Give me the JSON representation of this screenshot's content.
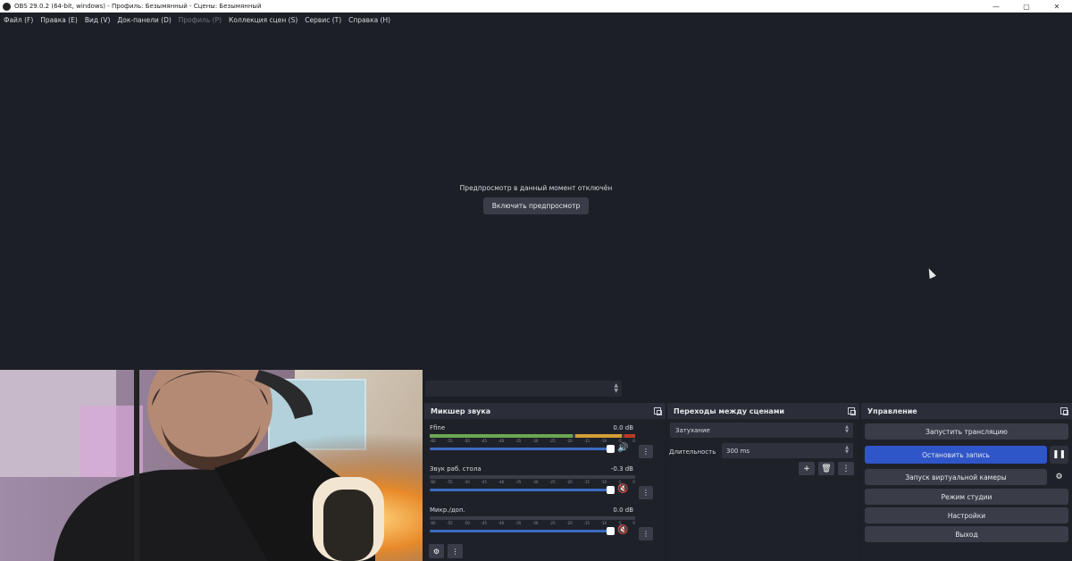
{
  "window": {
    "title": "OBS 29.0.2 (64-bit, windows) - Профиль: Безымянный - Сцены: Безымянный",
    "minimize": "—",
    "maximize": "▢",
    "close": "✕"
  },
  "menu": [
    {
      "label": "Файл (F)",
      "enabled": true
    },
    {
      "label": "Правка (E)",
      "enabled": true
    },
    {
      "label": "Вид (V)",
      "enabled": true
    },
    {
      "label": "Док-панели (D)",
      "enabled": true
    },
    {
      "label": "Профиль (P)",
      "enabled": false
    },
    {
      "label": "Коллекция сцен (S)",
      "enabled": true
    },
    {
      "label": "Сервис (T)",
      "enabled": true
    },
    {
      "label": "Справка (H)",
      "enabled": true
    }
  ],
  "preview": {
    "message": "Предпросмотр в данный момент отключён",
    "enable_button": "Включить предпросмотр"
  },
  "mixer": {
    "title": "Микшер звука",
    "ticks": [
      "-60",
      "-55",
      "-50",
      "-45",
      "-40",
      "-35",
      "-30",
      "-25",
      "-20",
      "-15",
      "-10",
      "-5",
      "0"
    ],
    "channels": [
      {
        "name": "Ffine",
        "db": "0.0 dB",
        "level": 1.0,
        "muted": false
      },
      {
        "name": "Звук раб. стола",
        "db": "-0.3 dB",
        "level": 0.0,
        "muted": true
      },
      {
        "name": "Микр./доп.",
        "db": "0.0 dB",
        "level": 0.0,
        "muted": true
      }
    ],
    "menu_glyph": "⋮",
    "settings_glyph": "⚙"
  },
  "transitions": {
    "title": "Переходы между сценами",
    "selected": "Затухание",
    "duration_label": "Длительность",
    "duration_value": "300 ms",
    "add": "+",
    "delete": "🗑",
    "more": "⋮"
  },
  "controls": {
    "title": "Управление",
    "start_stream": "Запустить трансляцию",
    "stop_recording": "Остановить запись",
    "pause_glyph": "❚❚",
    "virtual_camera": "Запуск виртуальной камеры",
    "gear_glyph": "⚙",
    "studio_mode": "Режим студии",
    "settings": "Настройки",
    "exit": "Выход"
  },
  "colors": {
    "accent": "#2f56c9",
    "background": "#1d1f27",
    "meter_green": "#6aa84f",
    "meter_yellow": "#d4a033",
    "muted_red": "#d0303a"
  }
}
